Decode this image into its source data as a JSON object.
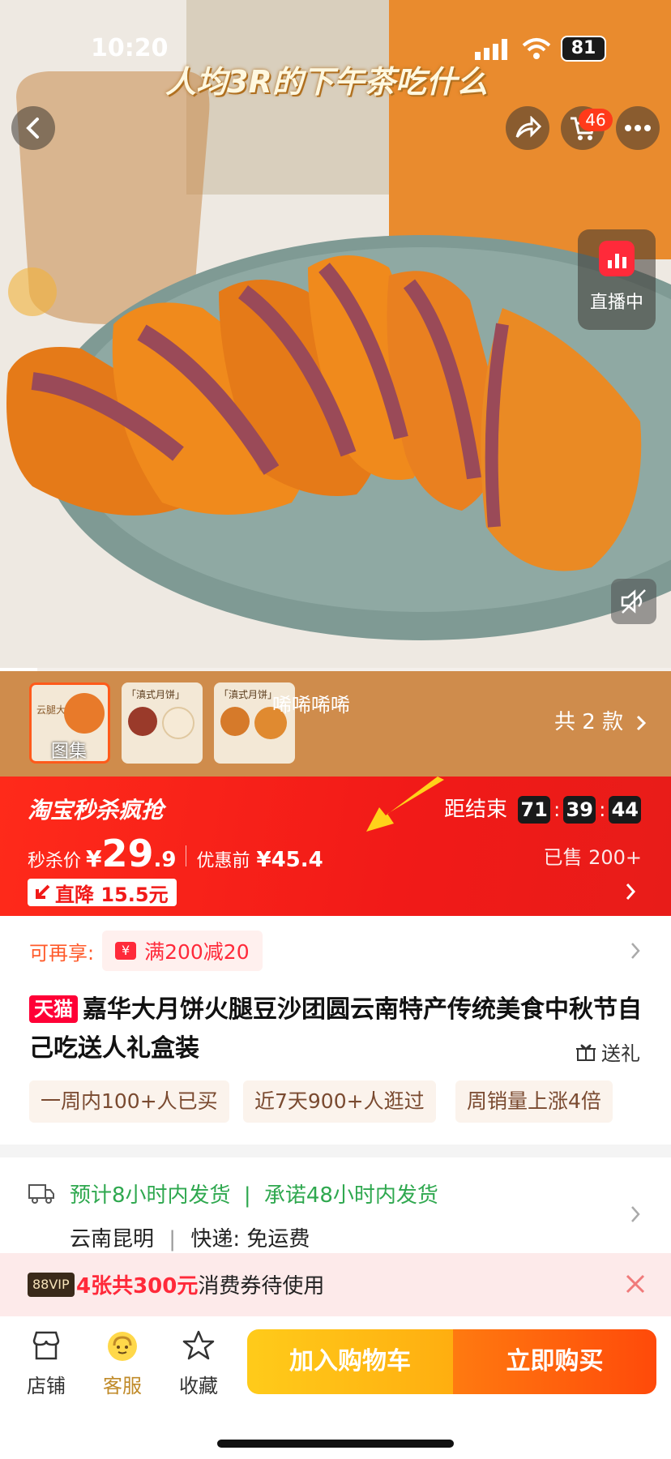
{
  "status_bar": {
    "time": "10:20",
    "battery": "81"
  },
  "hero": {
    "overlay_caption": "人均3R的下午茶吃什么",
    "cart_badge": "46",
    "live_label": "直播中"
  },
  "thumbnails": {
    "items": [
      {
        "label": "图集",
        "caption": "云腿大饼系列"
      },
      {
        "label": "",
        "caption": "「滇式月饼」"
      },
      {
        "label": "",
        "caption": "「滇式月饼」"
      }
    ],
    "overlay_text": "唏唏唏唏",
    "count_text": "共 2 款"
  },
  "flash_sale": {
    "brand": "淘宝秒杀疯抢",
    "countdown_label": "距结束",
    "hours": "71",
    "minutes": "39",
    "seconds": "44",
    "price_label": "秒杀价",
    "currency": "¥",
    "price_int": "29",
    "price_dec": ".9",
    "before_label": "优惠前",
    "before_price": "¥45.4",
    "sold": "已售 200+",
    "drop_label": "直降 15.5元"
  },
  "promo": {
    "label": "可再享:",
    "coupon": "满200减20"
  },
  "product": {
    "badge": "天猫",
    "title": "嘉华大月饼火腿豆沙团圆云南特产传统美食中秋节自己吃送人礼盒装",
    "gift_label": "送礼",
    "tags": [
      "一周内100+人已买",
      "近7天900+人逛过",
      "周销量上涨4倍"
    ]
  },
  "shipping": {
    "estimate": "预计8小时内发货",
    "promise": "承诺48小时内发货",
    "origin": "云南昆明",
    "express": "快递: 免运费"
  },
  "vip_bar": {
    "badge": "88VIP",
    "amount": "4张共300元",
    "text": "消费券待使用"
  },
  "bottom_nav": {
    "shop": "店铺",
    "service": "客服",
    "favorite": "收藏",
    "add_cart": "加入购物车",
    "buy_now": "立即购买"
  },
  "colors": {
    "accent": "#ff5000",
    "sale_red": "#f11a18",
    "green": "#2fa84f",
    "gold": "#ffc21a"
  }
}
